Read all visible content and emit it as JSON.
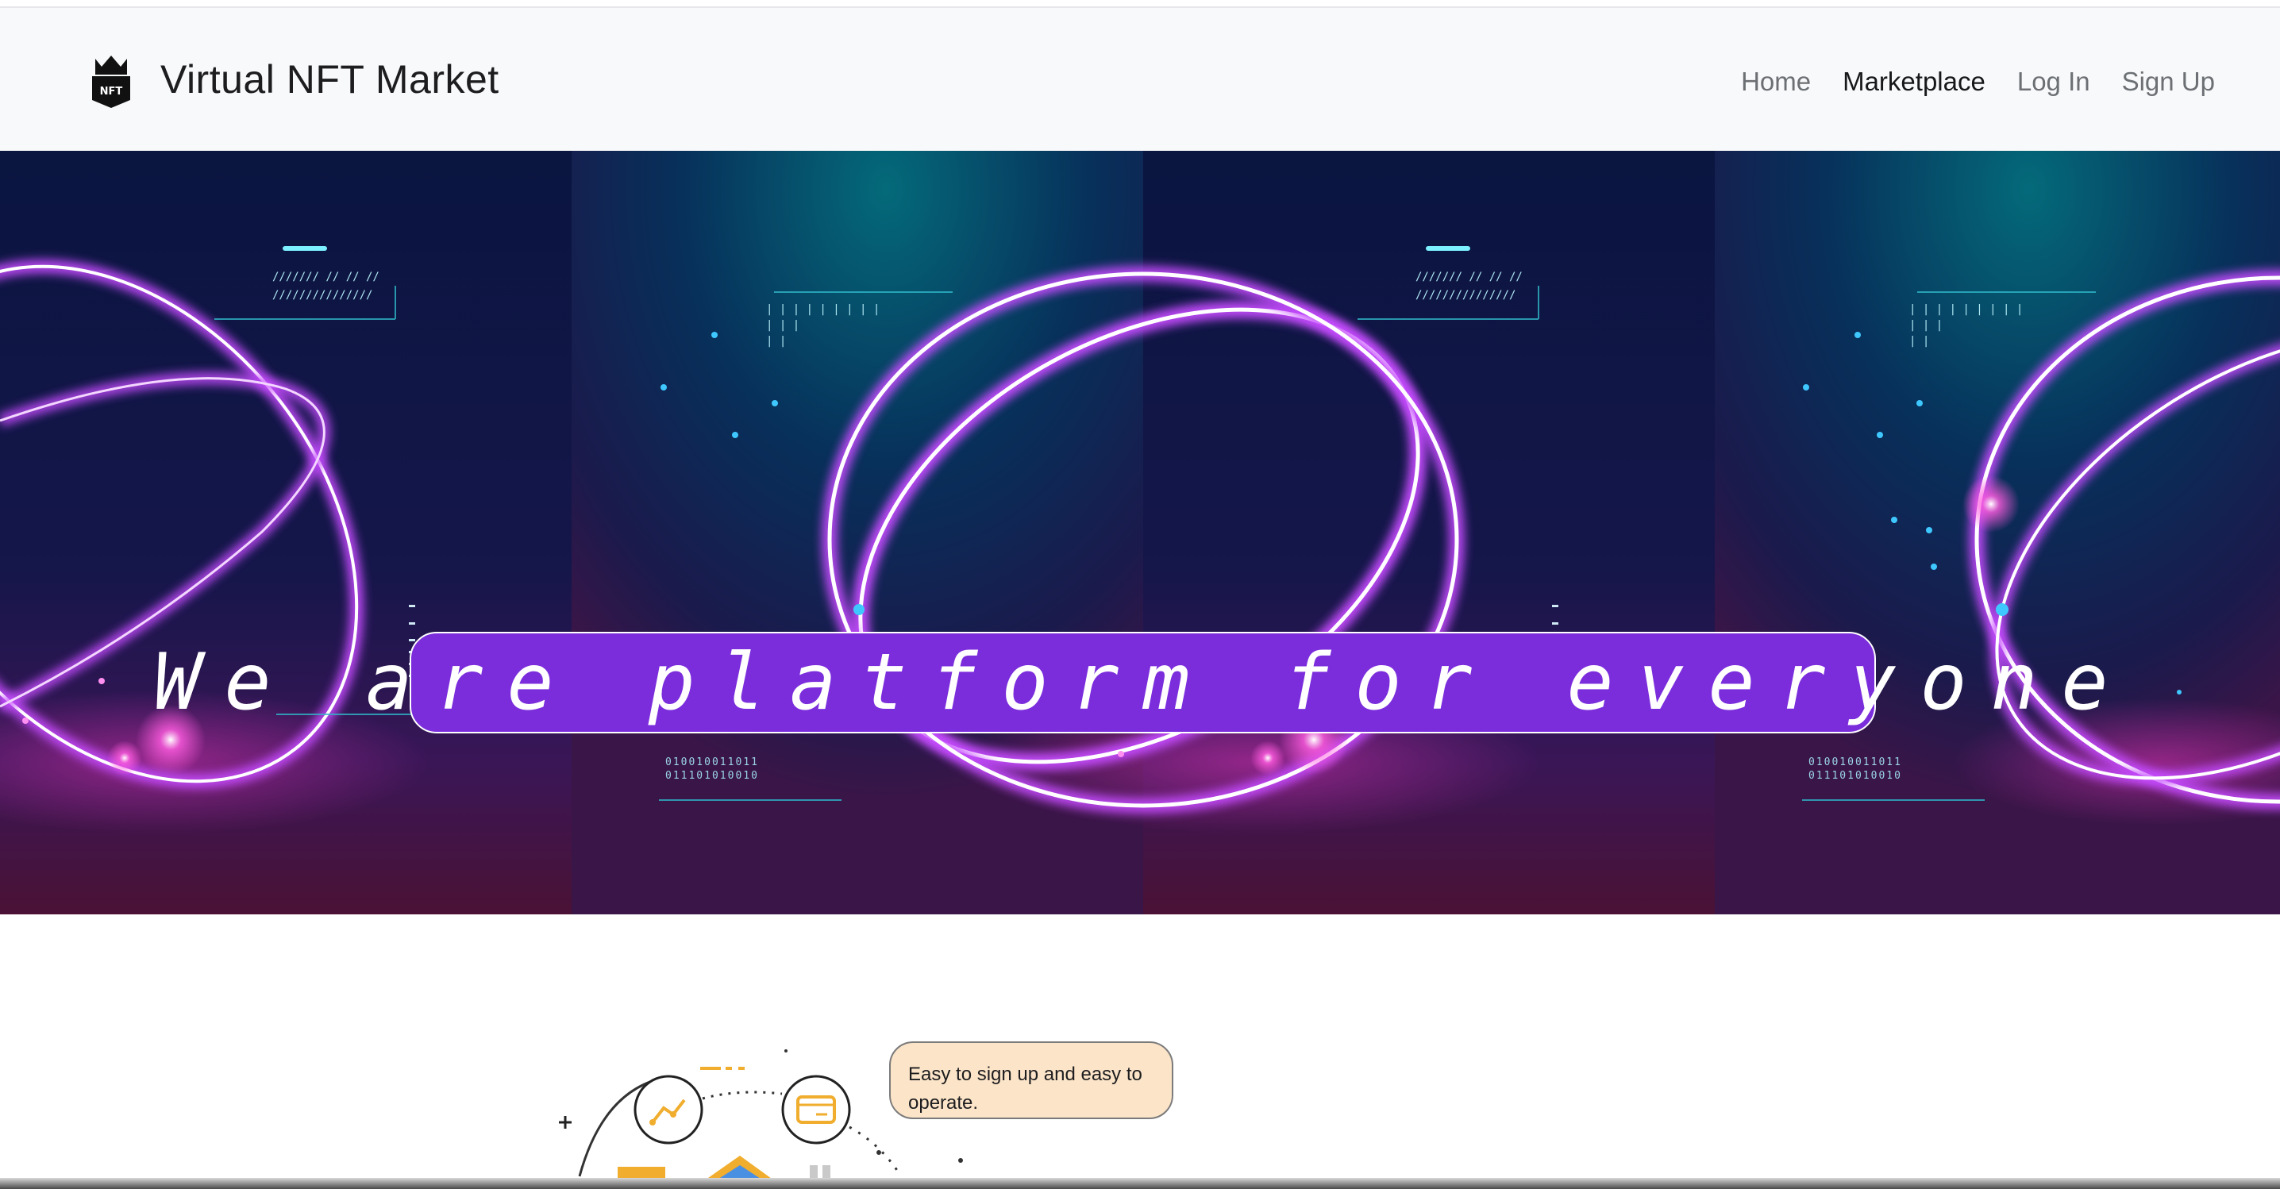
{
  "brand": {
    "logo_text": "NFT",
    "title": "Virtual NFT Market"
  },
  "nav": {
    "items": [
      "Home",
      "Marketplace",
      "Log In",
      "Sign Up"
    ],
    "active": "Marketplace"
  },
  "hero": {
    "headline": "We are platform for everyone",
    "binary_line_1": "010010011011",
    "binary_line_2": "011101010010"
  },
  "feature": {
    "bubble_text": "Easy to sign up and easy to operate."
  },
  "colors": {
    "headline_bg": "#7b2ddc",
    "bubble_bg": "#fbe4c8",
    "accent_gold": "#f0ad2e",
    "ring_purple": "#c64cff"
  }
}
